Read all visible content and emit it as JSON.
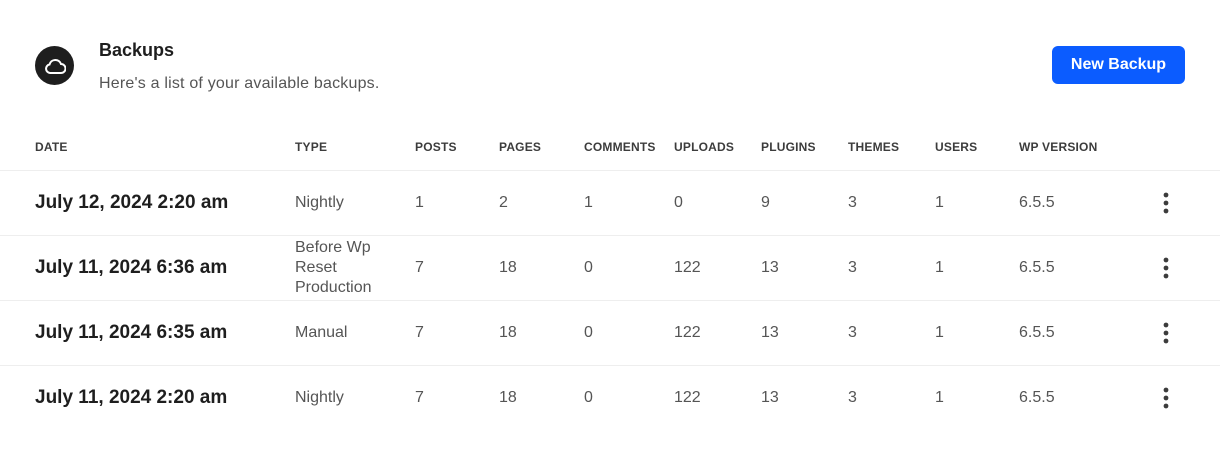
{
  "header": {
    "icon": "cloud-icon",
    "title": "Backups",
    "subtitle": "Here's a list of your available backups.",
    "new_backup_label": "New Backup",
    "accent_color": "#0b5cff"
  },
  "table": {
    "columns": [
      "DATE",
      "TYPE",
      "POSTS",
      "PAGES",
      "COMMENTS",
      "UPLOADS",
      "PLUGINS",
      "THEMES",
      "USERS",
      "WP VERSION"
    ],
    "rows": [
      {
        "date": "July 12, 2024 2:20 am",
        "type": "Nightly",
        "posts": "1",
        "pages": "2",
        "comments": "1",
        "uploads": "0",
        "plugins": "9",
        "themes": "3",
        "users": "1",
        "wp_version": "6.5.5"
      },
      {
        "date": "July 11, 2024 6:36 am",
        "type": "Before Wp Reset Production",
        "posts": "7",
        "pages": "18",
        "comments": "0",
        "uploads": "122",
        "plugins": "13",
        "themes": "3",
        "users": "1",
        "wp_version": "6.5.5"
      },
      {
        "date": "July 11, 2024 6:35 am",
        "type": "Manual",
        "posts": "7",
        "pages": "18",
        "comments": "0",
        "uploads": "122",
        "plugins": "13",
        "themes": "3",
        "users": "1",
        "wp_version": "6.5.5"
      },
      {
        "date": "July 11, 2024 2:20 am",
        "type": "Nightly",
        "posts": "7",
        "pages": "18",
        "comments": "0",
        "uploads": "122",
        "plugins": "13",
        "themes": "3",
        "users": "1",
        "wp_version": "6.5.5"
      }
    ],
    "row_action_icon": "more-vertical-icon"
  }
}
